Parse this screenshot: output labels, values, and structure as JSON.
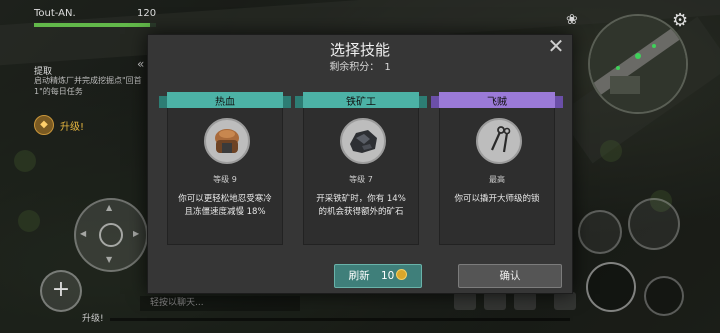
{
  "hud": {
    "player_name": "Tout-AN.",
    "player_level": "120",
    "hp_fraction": 0.95,
    "quest_title": "提取",
    "quest_desc": "启动精炼厂并完成挖掘点\"回首1\"的每日任务",
    "levelup_label": "升级!",
    "chat_placeholder": "轻按以聊天...",
    "xp_label": "升级!",
    "xp_fraction": 0.0
  },
  "modal": {
    "title": "选择技能",
    "points_label": "剩余积分：",
    "points_value": "1",
    "close_glyph": "✕",
    "cards": [
      {
        "name": "热血",
        "banner": "teal",
        "icon": "fur-hat-icon",
        "level": "等级 9",
        "desc": "你可以更轻松地忍受寒冷且冻僵速度减慢 18%"
      },
      {
        "name": "铁矿工",
        "banner": "teal",
        "icon": "iron-ore-icon",
        "level": "等级 7",
        "desc": "开采铁矿时，你有 14% 的机会获得额外的矿石"
      },
      {
        "name": "飞贼",
        "banner": "purple",
        "icon": "lockpick-icon",
        "level": "最高",
        "desc": "你可以撬开大师级的锁"
      }
    ],
    "refresh_label": "刷新",
    "refresh_cost": "10",
    "confirm_label": "确认"
  },
  "colors": {
    "teal_banner": "#4cb2a6",
    "purple_banner": "#9b7ad8",
    "refresh_button": "#3f7f7a",
    "hp_bar": "#62b84a"
  }
}
